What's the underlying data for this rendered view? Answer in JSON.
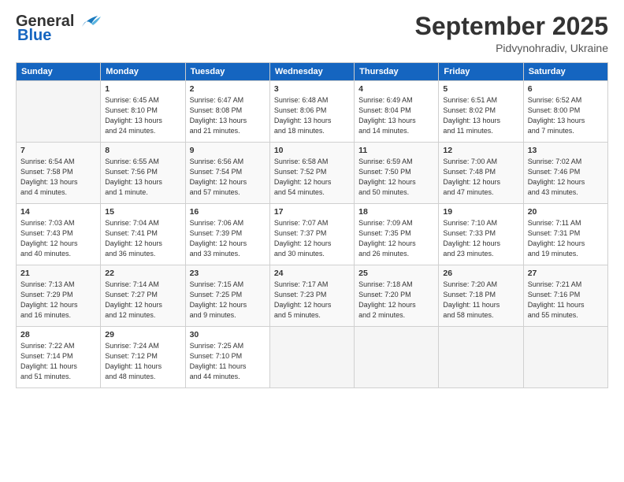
{
  "header": {
    "logo_line1": "General",
    "logo_line2": "Blue",
    "month": "September 2025",
    "location": "Pidvynohradiv, Ukraine"
  },
  "columns": [
    "Sunday",
    "Monday",
    "Tuesday",
    "Wednesday",
    "Thursday",
    "Friday",
    "Saturday"
  ],
  "weeks": [
    [
      {
        "day": "",
        "info": ""
      },
      {
        "day": "1",
        "info": "Sunrise: 6:45 AM\nSunset: 8:10 PM\nDaylight: 13 hours\nand 24 minutes."
      },
      {
        "day": "2",
        "info": "Sunrise: 6:47 AM\nSunset: 8:08 PM\nDaylight: 13 hours\nand 21 minutes."
      },
      {
        "day": "3",
        "info": "Sunrise: 6:48 AM\nSunset: 8:06 PM\nDaylight: 13 hours\nand 18 minutes."
      },
      {
        "day": "4",
        "info": "Sunrise: 6:49 AM\nSunset: 8:04 PM\nDaylight: 13 hours\nand 14 minutes."
      },
      {
        "day": "5",
        "info": "Sunrise: 6:51 AM\nSunset: 8:02 PM\nDaylight: 13 hours\nand 11 minutes."
      },
      {
        "day": "6",
        "info": "Sunrise: 6:52 AM\nSunset: 8:00 PM\nDaylight: 13 hours\nand 7 minutes."
      }
    ],
    [
      {
        "day": "7",
        "info": "Sunrise: 6:54 AM\nSunset: 7:58 PM\nDaylight: 13 hours\nand 4 minutes."
      },
      {
        "day": "8",
        "info": "Sunrise: 6:55 AM\nSunset: 7:56 PM\nDaylight: 13 hours\nand 1 minute."
      },
      {
        "day": "9",
        "info": "Sunrise: 6:56 AM\nSunset: 7:54 PM\nDaylight: 12 hours\nand 57 minutes."
      },
      {
        "day": "10",
        "info": "Sunrise: 6:58 AM\nSunset: 7:52 PM\nDaylight: 12 hours\nand 54 minutes."
      },
      {
        "day": "11",
        "info": "Sunrise: 6:59 AM\nSunset: 7:50 PM\nDaylight: 12 hours\nand 50 minutes."
      },
      {
        "day": "12",
        "info": "Sunrise: 7:00 AM\nSunset: 7:48 PM\nDaylight: 12 hours\nand 47 minutes."
      },
      {
        "day": "13",
        "info": "Sunrise: 7:02 AM\nSunset: 7:46 PM\nDaylight: 12 hours\nand 43 minutes."
      }
    ],
    [
      {
        "day": "14",
        "info": "Sunrise: 7:03 AM\nSunset: 7:43 PM\nDaylight: 12 hours\nand 40 minutes."
      },
      {
        "day": "15",
        "info": "Sunrise: 7:04 AM\nSunset: 7:41 PM\nDaylight: 12 hours\nand 36 minutes."
      },
      {
        "day": "16",
        "info": "Sunrise: 7:06 AM\nSunset: 7:39 PM\nDaylight: 12 hours\nand 33 minutes."
      },
      {
        "day": "17",
        "info": "Sunrise: 7:07 AM\nSunset: 7:37 PM\nDaylight: 12 hours\nand 30 minutes."
      },
      {
        "day": "18",
        "info": "Sunrise: 7:09 AM\nSunset: 7:35 PM\nDaylight: 12 hours\nand 26 minutes."
      },
      {
        "day": "19",
        "info": "Sunrise: 7:10 AM\nSunset: 7:33 PM\nDaylight: 12 hours\nand 23 minutes."
      },
      {
        "day": "20",
        "info": "Sunrise: 7:11 AM\nSunset: 7:31 PM\nDaylight: 12 hours\nand 19 minutes."
      }
    ],
    [
      {
        "day": "21",
        "info": "Sunrise: 7:13 AM\nSunset: 7:29 PM\nDaylight: 12 hours\nand 16 minutes."
      },
      {
        "day": "22",
        "info": "Sunrise: 7:14 AM\nSunset: 7:27 PM\nDaylight: 12 hours\nand 12 minutes."
      },
      {
        "day": "23",
        "info": "Sunrise: 7:15 AM\nSunset: 7:25 PM\nDaylight: 12 hours\nand 9 minutes."
      },
      {
        "day": "24",
        "info": "Sunrise: 7:17 AM\nSunset: 7:23 PM\nDaylight: 12 hours\nand 5 minutes."
      },
      {
        "day": "25",
        "info": "Sunrise: 7:18 AM\nSunset: 7:20 PM\nDaylight: 12 hours\nand 2 minutes."
      },
      {
        "day": "26",
        "info": "Sunrise: 7:20 AM\nSunset: 7:18 PM\nDaylight: 11 hours\nand 58 minutes."
      },
      {
        "day": "27",
        "info": "Sunrise: 7:21 AM\nSunset: 7:16 PM\nDaylight: 11 hours\nand 55 minutes."
      }
    ],
    [
      {
        "day": "28",
        "info": "Sunrise: 7:22 AM\nSunset: 7:14 PM\nDaylight: 11 hours\nand 51 minutes."
      },
      {
        "day": "29",
        "info": "Sunrise: 7:24 AM\nSunset: 7:12 PM\nDaylight: 11 hours\nand 48 minutes."
      },
      {
        "day": "30",
        "info": "Sunrise: 7:25 AM\nSunset: 7:10 PM\nDaylight: 11 hours\nand 44 minutes."
      },
      {
        "day": "",
        "info": ""
      },
      {
        "day": "",
        "info": ""
      },
      {
        "day": "",
        "info": ""
      },
      {
        "day": "",
        "info": ""
      }
    ]
  ]
}
